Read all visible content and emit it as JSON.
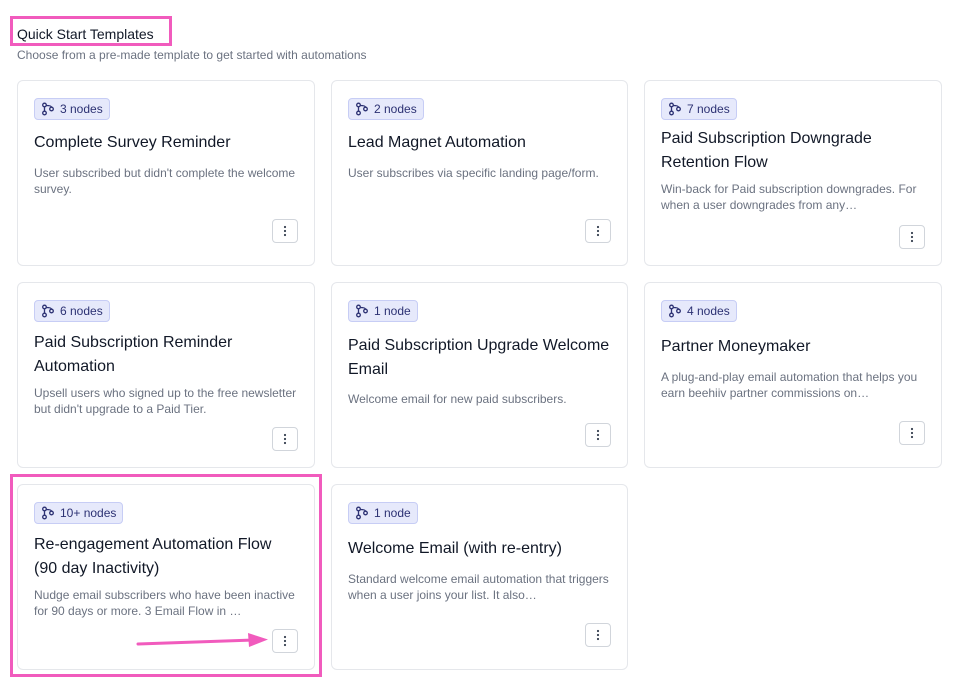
{
  "header": {
    "title": "Quick Start Templates",
    "subtitle": "Choose from a pre-made template to get started with automations"
  },
  "colors": {
    "highlight": "#f15bbd",
    "badge_bg": "#e6e9fb",
    "badge_text": "#2c3173"
  },
  "icons": {
    "badge": "workflow-nodes-icon",
    "more": "vertical-ellipsis-icon",
    "annotation": "pink-arrow-icon"
  },
  "templates": [
    {
      "badge": "3 nodes",
      "title": "Complete Survey Reminder",
      "description": "User subscribed but didn't complete the welcome survey."
    },
    {
      "badge": "2 nodes",
      "title": "Lead Magnet Automation",
      "description": "User subscribes via specific landing page/form."
    },
    {
      "badge": "7 nodes",
      "title": "Paid Subscription Downgrade Retention Flow",
      "description": "Win-back for Paid subscription downgrades. For when a user downgrades from any…"
    },
    {
      "badge": "6 nodes",
      "title": "Paid Subscription Reminder Automation",
      "description": "Upsell users who signed up to the free newsletter but didn't upgrade to a Paid Tier."
    },
    {
      "badge": "1 node",
      "title": "Paid Subscription Upgrade Welcome Email",
      "description": "Welcome email for new paid subscribers."
    },
    {
      "badge": "4 nodes",
      "title": "Partner Moneymaker",
      "description": "A plug-and-play email automation that helps you earn beehiiv partner commissions on…"
    },
    {
      "badge": "10+ nodes",
      "title": "Re-engagement Automation Flow (90 day Inactivity)",
      "description": "Nudge email subscribers who have been inactive for 90 days or more. 3 Email Flow in …"
    },
    {
      "badge": "1 node",
      "title": "Welcome Email (with re-entry)",
      "description": "Standard welcome email automation that triggers when a user joins your list. It also…"
    }
  ]
}
